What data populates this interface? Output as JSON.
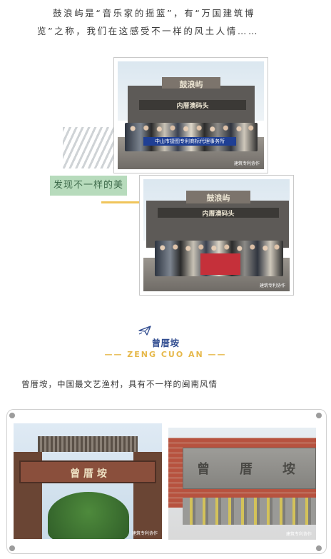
{
  "intro": {
    "line1": "鼓浪屿是“音乐家的摇篮”，有“万国建筑博",
    "line2": "览”之称，我们在这感受不一样的风土人情……"
  },
  "photos": {
    "photo1": {
      "sign_main": "鼓浪屿",
      "sign_sub": "内厝澳码头",
      "banner_text": "中山市捷图专利商标代理事务所",
      "watermark": "建筑专利协作"
    },
    "photo2": {
      "sign_main": "鼓浪屿",
      "sign_sub": "内厝澳码头",
      "watermark": "建筑专利协作"
    }
  },
  "label": {
    "text": "发现不一样的美"
  },
  "section": {
    "icon": "paper-plane-icon",
    "title": "曾厝垵",
    "subtitle": "—— ZENG CUO AN ——",
    "description": "曾厝垵，中国最文艺渔村，具有不一样的闽南风情"
  },
  "gallery": {
    "left": {
      "arch_text": "曾 厝 垵",
      "watermark": "建筑专利协作"
    },
    "right": {
      "stone_text_1": "曾",
      "stone_text_2": "厝",
      "stone_text_3": "垵",
      "watermark": "建筑专利协作"
    }
  },
  "colors": {
    "accent_blue": "#2f4b8f",
    "accent_gold": "#e6b84a",
    "label_green": "#b7dbbc"
  }
}
